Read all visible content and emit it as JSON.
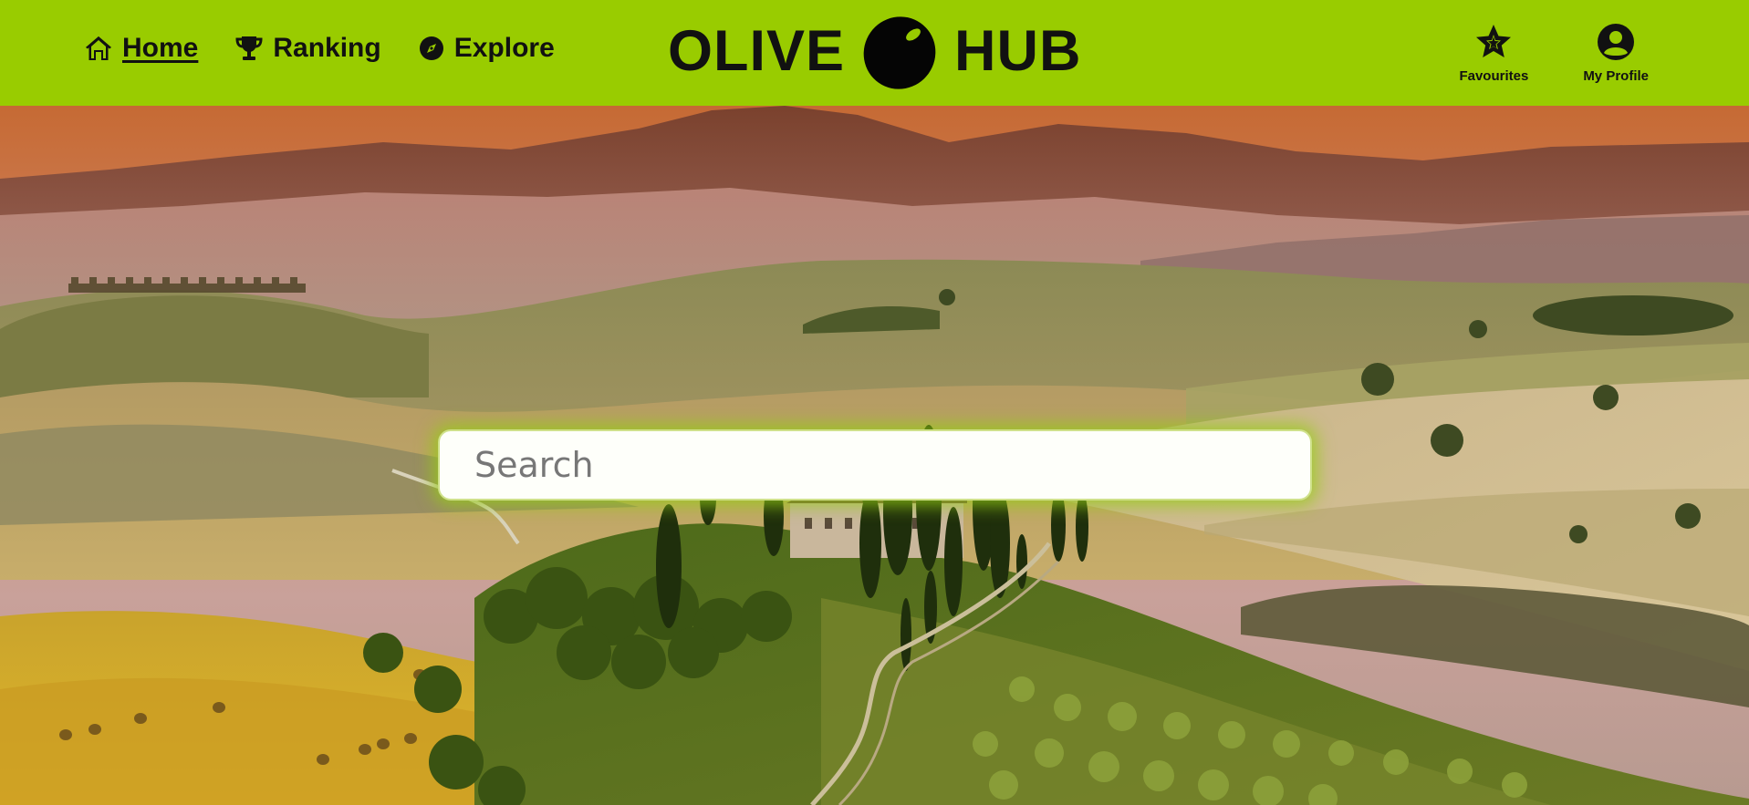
{
  "nav": {
    "links": [
      {
        "label": "Home",
        "icon": "home-icon",
        "active": true
      },
      {
        "label": "Ranking",
        "icon": "trophy-icon",
        "active": false
      },
      {
        "label": "Explore",
        "icon": "compass-icon",
        "active": false
      }
    ],
    "logo": {
      "left": "OLIVE",
      "right": "HUB",
      "icon": "olive-icon"
    },
    "buttons": [
      {
        "label": "Favourites",
        "icon": "star-icon"
      },
      {
        "label": "My Profile",
        "icon": "user-circle-icon"
      }
    ]
  },
  "search": {
    "placeholder": "Search",
    "value": ""
  },
  "colors": {
    "navbar": "#99cc00",
    "text": "#111111",
    "search_glow": "#96cd14"
  }
}
